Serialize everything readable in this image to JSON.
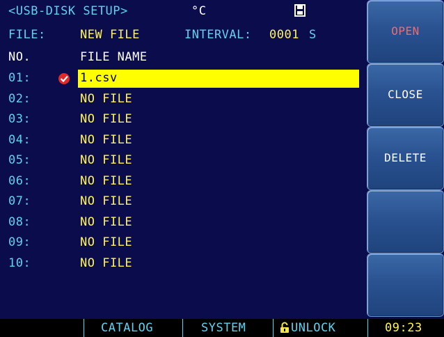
{
  "header": {
    "title": "<USB-DISK SETUP>",
    "unit": "°C",
    "disk_icon": "floppy-disk-icon"
  },
  "file_info": {
    "file_label": "FILE:",
    "file_value": "NEW FILE",
    "interval_label": "INTERVAL:",
    "interval_value": "0001",
    "interval_unit": "S"
  },
  "columns": {
    "no": "NO.",
    "name": "FILE NAME"
  },
  "files": [
    {
      "no": "01:",
      "name": "1.csv",
      "selected": true
    },
    {
      "no": "02:",
      "name": "NO FILE"
    },
    {
      "no": "03:",
      "name": "NO FILE"
    },
    {
      "no": "04:",
      "name": "NO FILE"
    },
    {
      "no": "05:",
      "name": "NO FILE"
    },
    {
      "no": "06:",
      "name": "NO FILE"
    },
    {
      "no": "07:",
      "name": "NO FILE"
    },
    {
      "no": "08:",
      "name": "NO FILE"
    },
    {
      "no": "09:",
      "name": "NO FILE"
    },
    {
      "no": "10:",
      "name": "NO FILE"
    }
  ],
  "softkeys": [
    "OPEN",
    "CLOSE",
    "DELETE",
    "",
    ""
  ],
  "bottom_bar": {
    "catalog": "CATALOG",
    "system": "SYSTEM",
    "lock": "UNLOCK",
    "lock_icon": "padlock-icon",
    "clock": "09:23"
  },
  "colors": {
    "background": "#0b0c4c",
    "cyan": "#5fd2ee",
    "yellow": "#fff45a",
    "selection": "#ffff00",
    "open_label": "#f06c6c",
    "softkey": "#2a5291"
  }
}
